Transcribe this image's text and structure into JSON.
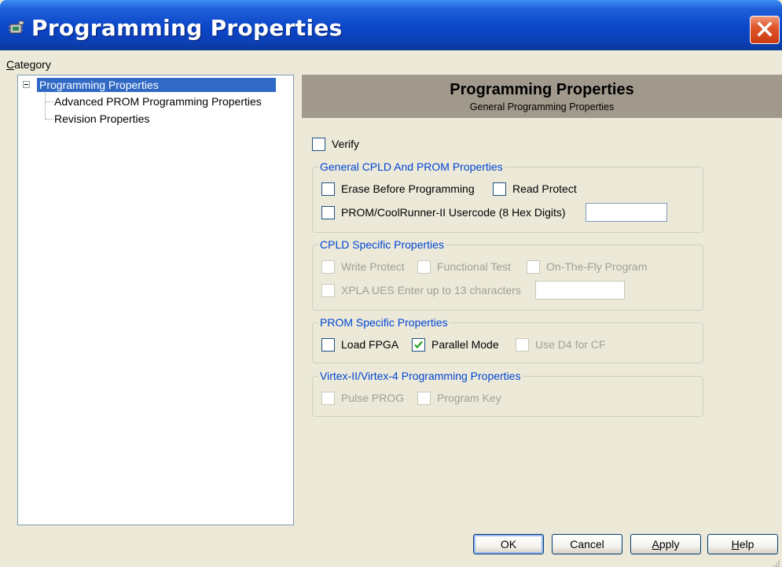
{
  "window": {
    "title": "Programming Properties",
    "app_icon": "chip-programmer-icon",
    "close_icon": "close-icon"
  },
  "category": {
    "label": "Category",
    "tree": {
      "root": "Programming Properties",
      "children": [
        "Advanced PROM Programming Properties",
        "Revision Properties"
      ]
    }
  },
  "panel": {
    "title": "Programming Properties",
    "subtitle": "General Programming Properties"
  },
  "verify": {
    "label": "Verify",
    "checked": false,
    "enabled": true
  },
  "groups": {
    "general": {
      "title": "General CPLD And PROM Properties",
      "erase_before_programming": {
        "label": "Erase Before Programming",
        "checked": false,
        "enabled": true
      },
      "read_protect": {
        "label": "Read Protect",
        "checked": false,
        "enabled": true
      },
      "usercode": {
        "label": "PROM/CoolRunner-II Usercode (8 Hex Digits)",
        "checked": false,
        "enabled": true,
        "value": ""
      }
    },
    "cpld": {
      "title": "CPLD Specific Properties",
      "write_protect": {
        "label": "Write Protect",
        "checked": false,
        "enabled": false
      },
      "functional_test": {
        "label": "Functional Test",
        "checked": false,
        "enabled": false
      },
      "on_the_fly": {
        "label": "On-The-Fly Program",
        "checked": false,
        "enabled": false
      },
      "xpla_ues": {
        "label": "XPLA UES Enter up to 13 characters",
        "checked": false,
        "enabled": false,
        "value": ""
      }
    },
    "prom": {
      "title": "PROM Specific Properties",
      "load_fpga": {
        "label": "Load FPGA",
        "checked": false,
        "enabled": true
      },
      "parallel_mode": {
        "label": "Parallel Mode",
        "checked": true,
        "enabled": true
      },
      "use_d4": {
        "label": "Use D4 for CF",
        "checked": false,
        "enabled": false
      }
    },
    "virtex": {
      "title": "Virtex-II/Virtex-4 Programming Properties",
      "pulse_prog": {
        "label": "Pulse PROG",
        "checked": false,
        "enabled": false
      },
      "program_key": {
        "label": "Program Key",
        "checked": false,
        "enabled": false
      }
    }
  },
  "buttons": {
    "ok": "OK",
    "cancel": "Cancel",
    "apply": "Apply",
    "help": "Help"
  },
  "colors": {
    "titlebar": "#0a46c9",
    "selection": "#316ac5",
    "header": "#a19a8c",
    "group_title": "#0046d5",
    "check": "#21a121"
  }
}
